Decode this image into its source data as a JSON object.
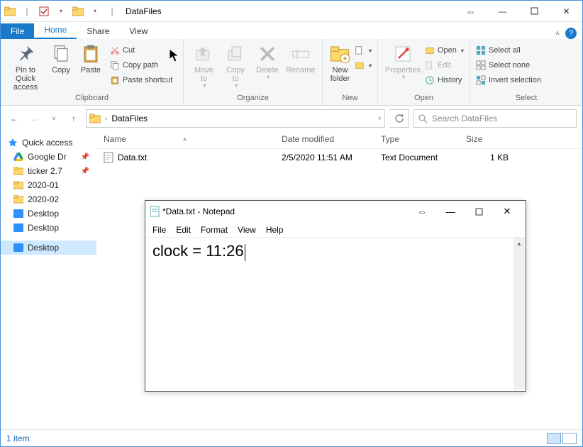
{
  "window": {
    "title": "DataFiles"
  },
  "tabs": {
    "file": "File",
    "home": "Home",
    "share": "Share",
    "view": "View"
  },
  "ribbon": {
    "clipboard": {
      "pin": "Pin to Quick\naccess",
      "copy": "Copy",
      "paste": "Paste",
      "cut": "Cut",
      "copypath": "Copy path",
      "shortcut": "Paste shortcut",
      "label": "Clipboard"
    },
    "organize": {
      "moveto": "Move\nto",
      "copyto": "Copy\nto",
      "delete": "Delete",
      "rename": "Rename",
      "label": "Organize"
    },
    "new": {
      "newfolder": "New\nfolder",
      "label": "New"
    },
    "open": {
      "properties": "Properties",
      "open": "Open",
      "edit": "Edit",
      "history": "History",
      "label": "Open"
    },
    "select": {
      "all": "Select all",
      "none": "Select none",
      "invert": "Invert selection",
      "label": "Select"
    }
  },
  "address": {
    "path": "DataFiles"
  },
  "search": {
    "placeholder": "Search DataFiles"
  },
  "sidebar": {
    "quick": "Quick access",
    "items": [
      {
        "label": "Google Dr",
        "pinned": true,
        "icon": "gdrive"
      },
      {
        "label": "ticker 2.7",
        "pinned": true,
        "icon": "folder"
      },
      {
        "label": "2020-01",
        "pinned": false,
        "icon": "folder"
      },
      {
        "label": "2020-02",
        "pinned": false,
        "icon": "folder"
      },
      {
        "label": "Desktop",
        "pinned": false,
        "icon": "desktop"
      },
      {
        "label": "Desktop",
        "pinned": false,
        "icon": "desktop"
      }
    ],
    "selected": "Desktop"
  },
  "columns": {
    "name": "Name",
    "modified": "Date modified",
    "type": "Type",
    "size": "Size"
  },
  "files": [
    {
      "name": "Data.txt",
      "modified": "2/5/2020 11:51 AM",
      "type": "Text Document",
      "size": "1 KB"
    }
  ],
  "status": {
    "count": "1 item"
  },
  "notepad": {
    "title": "*Data.txt - Notepad",
    "menu": [
      "File",
      "Edit",
      "Format",
      "View",
      "Help"
    ],
    "content": "clock = 11:26"
  }
}
